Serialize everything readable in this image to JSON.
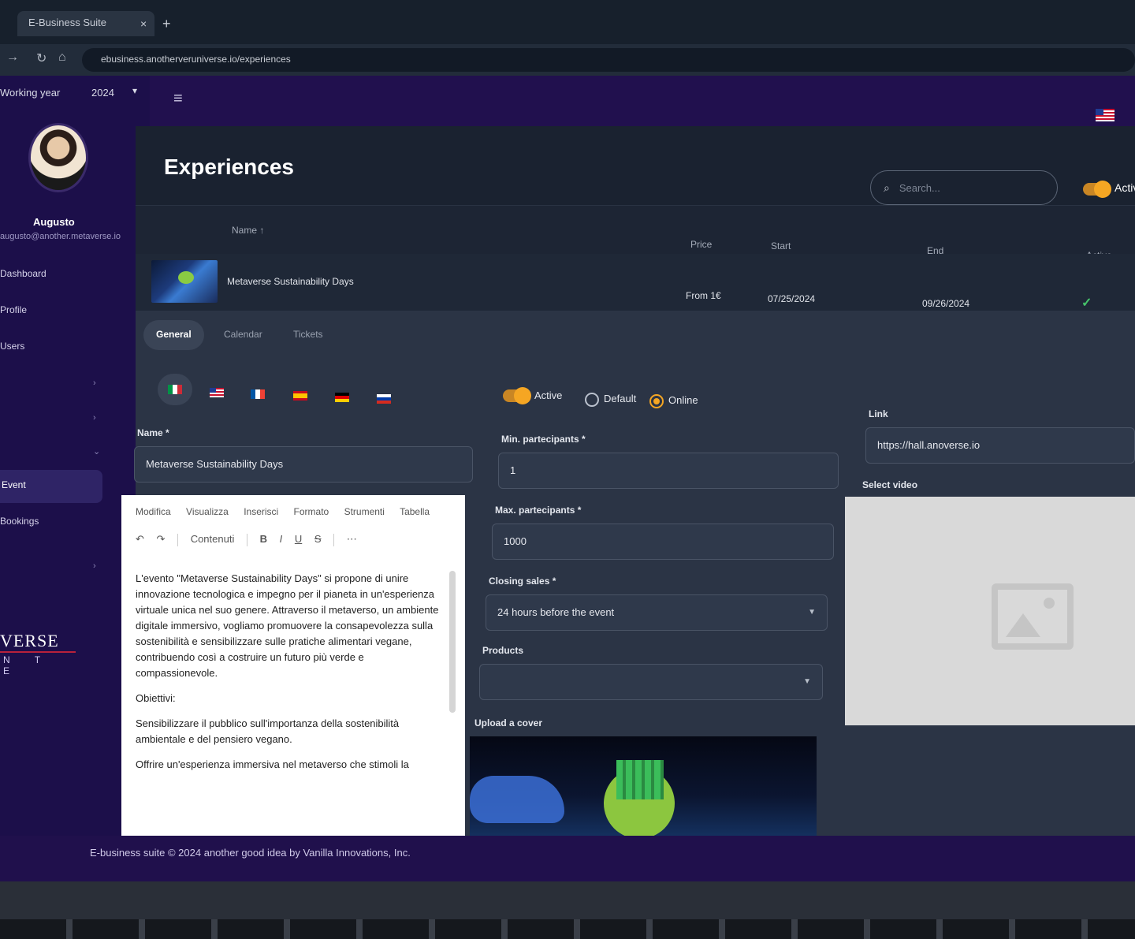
{
  "browser": {
    "tab_title": "E-Business Suite",
    "close_glyph": "×",
    "new_tab_glyph": "+",
    "url": "ebusiness.anotherveruniverse.io/experiences"
  },
  "sidebar": {
    "year_label": "Working year",
    "year_value": "2024",
    "user_name": "Augusto",
    "user_email": "augusto@another.metaverse.io",
    "items": [
      {
        "label": "Dashboard"
      },
      {
        "label": "Profile"
      },
      {
        "label": "Users"
      },
      {
        "label": "Event"
      },
      {
        "label": "Bookings"
      }
    ],
    "brand": "VERSE",
    "brand_sub": "N T E"
  },
  "header": {
    "menu_glyph": "≡"
  },
  "page": {
    "title": "Experiences",
    "search_placeholder": "Search...",
    "search_icon": "search-icon",
    "active_toggle_label": "Active"
  },
  "table": {
    "columns": [
      "Name ↑",
      "Price",
      "Start",
      "End",
      "Active"
    ],
    "row": {
      "name": "Metaverse Sustainability Days",
      "price": "From 1€",
      "start": "07/25/2024",
      "end": "09/26/2024",
      "active_glyph": "✓"
    }
  },
  "panel": {
    "tabs": [
      "General",
      "Calendar",
      "Tickets"
    ],
    "languages": [
      "it",
      "en",
      "fr",
      "es",
      "de",
      "ru"
    ],
    "name_label": "Name *",
    "name_value": "Metaverse Sustainability Days",
    "active_label": "Active",
    "default_label": "Default",
    "online_label": "Online",
    "min_label": "Min. partecipants *",
    "min_value": "1",
    "max_label": "Max. partecipants *",
    "max_value": "1000",
    "closing_label": "Closing sales *",
    "closing_value": "24 hours before the event",
    "products_label": "Products",
    "upload_label": "Upload a cover",
    "link_label": "Link",
    "link_value": "https://hall.anoverse.io",
    "video_label": "Select video"
  },
  "editor": {
    "menu": [
      "Modifica",
      "Visualizza",
      "Inserisci",
      "Formato",
      "Strumenti",
      "Tabella"
    ],
    "tools": [
      "↶",
      "↷",
      "Contenuti",
      "B",
      "I",
      "U",
      "S",
      "⋯"
    ],
    "paragraph1": "L'evento \"Metaverse Sustainability Days\" si propone di unire innovazione tecnologica e impegno per il pianeta in un'esperienza virtuale unica nel suo genere. Attraverso il metaverso, un ambiente digitale immersivo, vogliamo promuovere la consapevolezza sulla sostenibilità e sensibilizzare sulle pratiche alimentari vegane, contribuendo così a costruire un futuro più verde e compassionevole.",
    "heading": "Obiettivi:",
    "paragraph2": "Sensibilizzare il pubblico sull'importanza della sostenibilità ambientale e del pensiero vegano.",
    "paragraph3": "Offrire un'esperienza immersiva nel metaverso che stimoli la"
  },
  "footer": {
    "text": "E-business suite © 2024 another good idea by Vanilla Innovations, Inc."
  },
  "colors": {
    "sidebar": "#1c0f4a",
    "accent": "#f5a623",
    "content": "#1a2230",
    "success": "#46c46b"
  }
}
